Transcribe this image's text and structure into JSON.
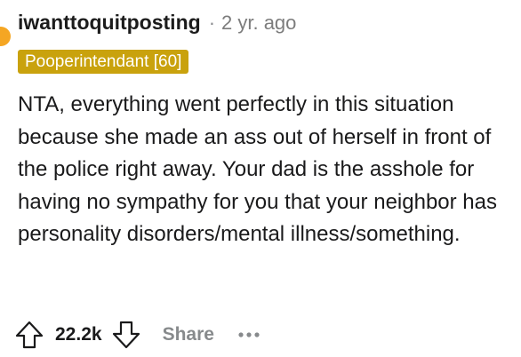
{
  "comment": {
    "username": "iwanttoquitposting",
    "separator": "·",
    "timestamp": "2 yr. ago",
    "flair": "Pooperintendant [60]",
    "body": "NTA, everything went perfectly in this situation because she made an ass out of herself in front of the police right away. Your dad is the asshole for having no sympathy for you that your neighbor has personality disorders/mental illness/something."
  },
  "actions": {
    "upvote_icon": "arrow-up-outline-icon",
    "vote_count": "22.2k",
    "downvote_icon": "arrow-down-outline-icon",
    "share_label": "Share",
    "more_icon": "ellipsis-icon"
  },
  "colors": {
    "flair_background": "#c9a20d",
    "flair_text": "#ffffff",
    "username": "#1c1c1c",
    "muted": "#7c7c7c",
    "body_text": "#1a1a1b",
    "avatar": "#f5a623"
  }
}
